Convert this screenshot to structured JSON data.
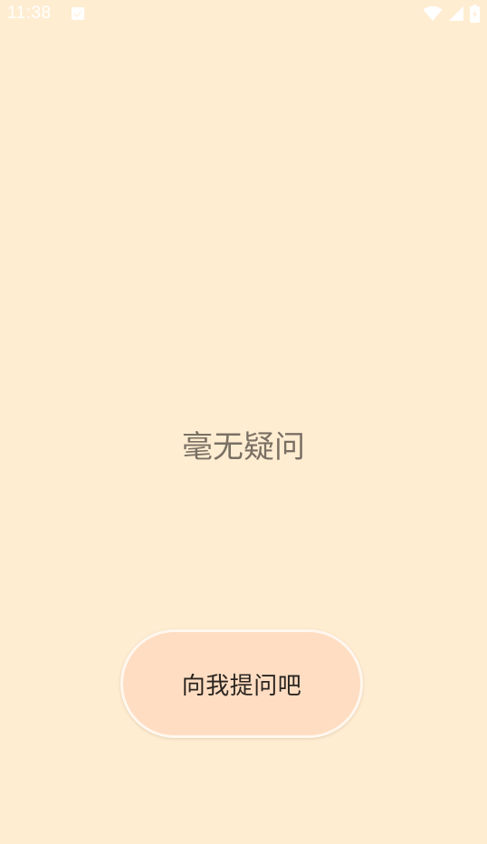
{
  "status_bar": {
    "time": "11:38",
    "icons": [
      "notification-icon",
      "wifi-icon",
      "cell-signal-icon",
      "battery-charging-icon"
    ]
  },
  "main": {
    "empty_message": "毫无疑问"
  },
  "actions": {
    "ask_button_label": "向我提问吧"
  },
  "colors": {
    "background": "#FFEDD2",
    "button_fill": "#FFDDC2",
    "button_border": "#FFF7EE",
    "empty_text": "#7A7064",
    "button_text": "#2A2520",
    "status_icons": "#FFFFFF"
  }
}
